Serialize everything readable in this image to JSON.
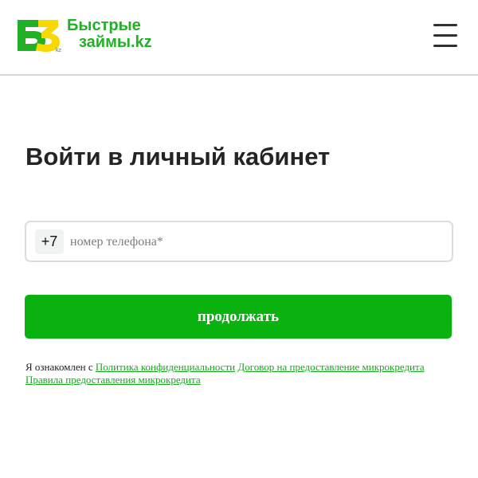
{
  "header": {
    "logo": {
      "mark_text": "БЗ",
      "mark_suffix": "kz",
      "line1": "Быстрые",
      "line2": "займы.kz",
      "primary_color": "#21b126",
      "accent_color": "#f7d900"
    },
    "menu_icon": "hamburger-menu-icon"
  },
  "main": {
    "title": "Войти в личный кабинет",
    "phone": {
      "country_code": "+7",
      "placeholder": "номер телефона*",
      "value": ""
    },
    "continue_label": "продолжать",
    "agreement": {
      "prefix": "Я ознакомлен с",
      "links": [
        "Политика конфиденциальности",
        "Договор на предоставление микрокредита",
        "Правила предоставления микрокредита"
      ]
    }
  },
  "colors": {
    "button_green": "#0ab20f",
    "link_green": "#18a81d",
    "text_dark": "#242424",
    "border_gray": "#dddddd"
  }
}
